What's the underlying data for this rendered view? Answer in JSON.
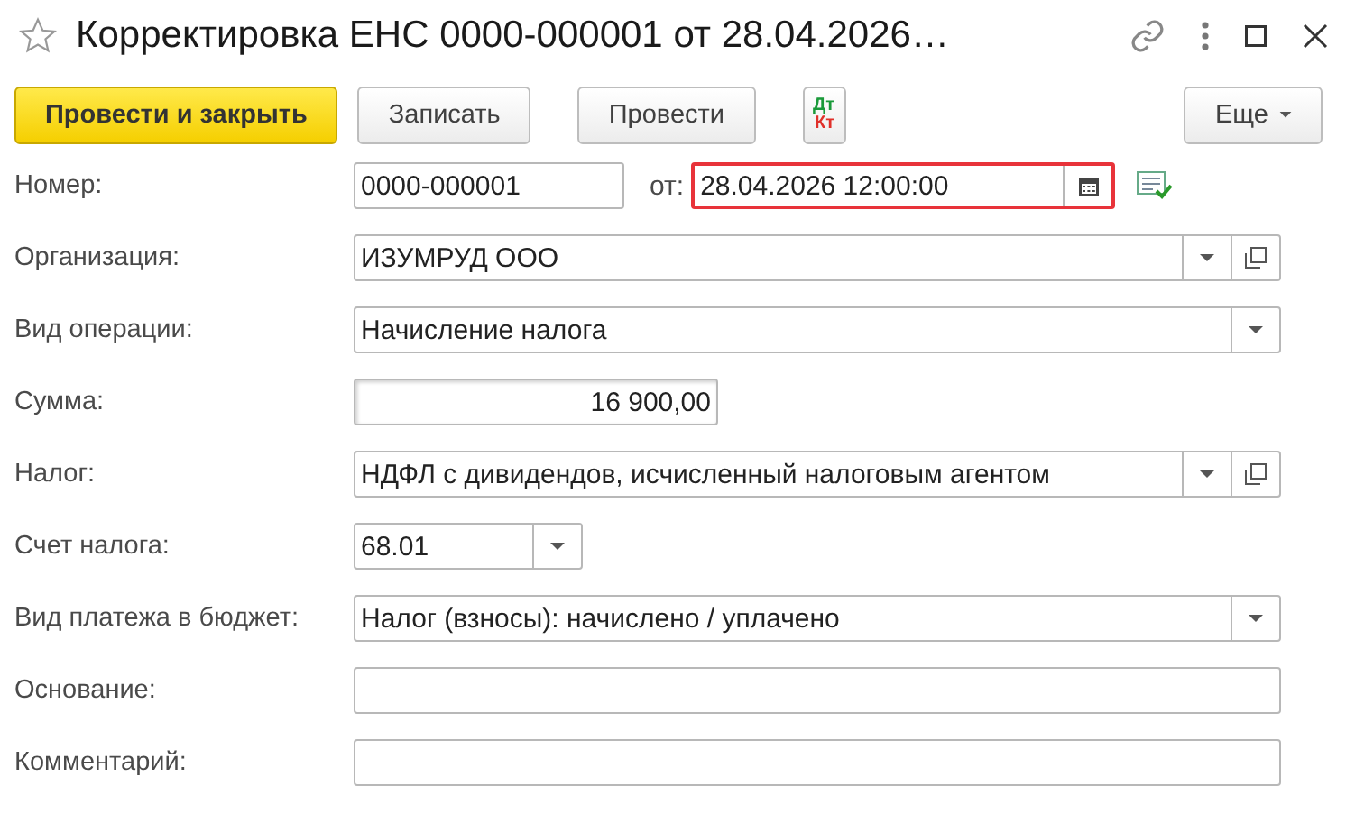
{
  "window": {
    "title": "Корректировка ЕНС 0000-000001 от 28.04.2026…"
  },
  "toolbar": [
    {
      "kind": "primary",
      "label": "Провести и закрыть"
    },
    {
      "kind": "normal",
      "label": "Записать"
    },
    {
      "kind": "normal",
      "label": "Провести"
    },
    {
      "kind": "dtkt",
      "dt": "Дт",
      "kt": "Кт"
    },
    {
      "kind": "more",
      "label": "Еще"
    }
  ],
  "number_row": {
    "label": "Номер:",
    "number": "0000-000001",
    "date_label": "от:",
    "date": "28.04.2026 12:00:00",
    "date_focused": true
  },
  "fields": [
    {
      "label": "Организация:",
      "kind": "select_open",
      "value": "ИЗУМРУД ООО"
    },
    {
      "label": "Вид операции:",
      "kind": "select",
      "value": "Начисление налога"
    },
    {
      "label": "Сумма:",
      "kind": "number",
      "value": "16 900,00"
    },
    {
      "label": "Налог:",
      "kind": "select_open",
      "value": "НДФЛ с дивидендов, исчисленный налоговым агентом"
    },
    {
      "label": "Счет налога:",
      "kind": "select",
      "value": "68.01"
    },
    {
      "label": "Вид платежа в бюджет:",
      "kind": "select",
      "value": "Налог (взносы): начислено / уплачено"
    },
    {
      "label": "Основание:",
      "kind": "text"
    },
    {
      "label": "Комментарий:",
      "kind": "text"
    }
  ]
}
